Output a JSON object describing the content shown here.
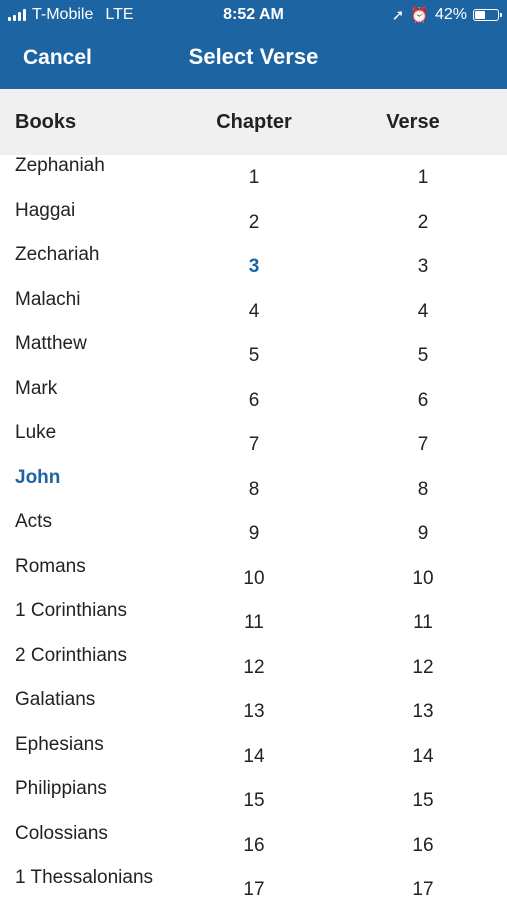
{
  "status": {
    "carrier": "T-Mobile",
    "network": "LTE",
    "time": "8:52 AM",
    "battery": "42%"
  },
  "nav": {
    "cancel_label": "Cancel",
    "title": "Select Verse"
  },
  "columns": {
    "books": "Books",
    "chapter": "Chapter",
    "verse": "Verse"
  },
  "books": [
    "Zephaniah",
    "Haggai",
    "Zechariah",
    "Malachi",
    "Matthew",
    "Mark",
    "Luke",
    "John",
    "Acts",
    "Romans",
    "1 Corinthians",
    "2 Corinthians",
    "Galatians",
    "Ephesians",
    "Philippians",
    "Colossians",
    "1 Thessalonians"
  ],
  "chapters": [
    "1",
    "2",
    "3",
    "4",
    "5",
    "6",
    "7",
    "8",
    "9",
    "10",
    "11",
    "12",
    "13",
    "14",
    "15",
    "16",
    "17"
  ],
  "verses": [
    "1",
    "2",
    "3",
    "4",
    "5",
    "6",
    "7",
    "8",
    "9",
    "10",
    "11",
    "12",
    "13",
    "14",
    "15",
    "16",
    "17"
  ],
  "selected": {
    "book": "John",
    "chapter": "3"
  },
  "colors": {
    "accent": "#1d64a3",
    "header_bg": "#f0f0f0"
  }
}
